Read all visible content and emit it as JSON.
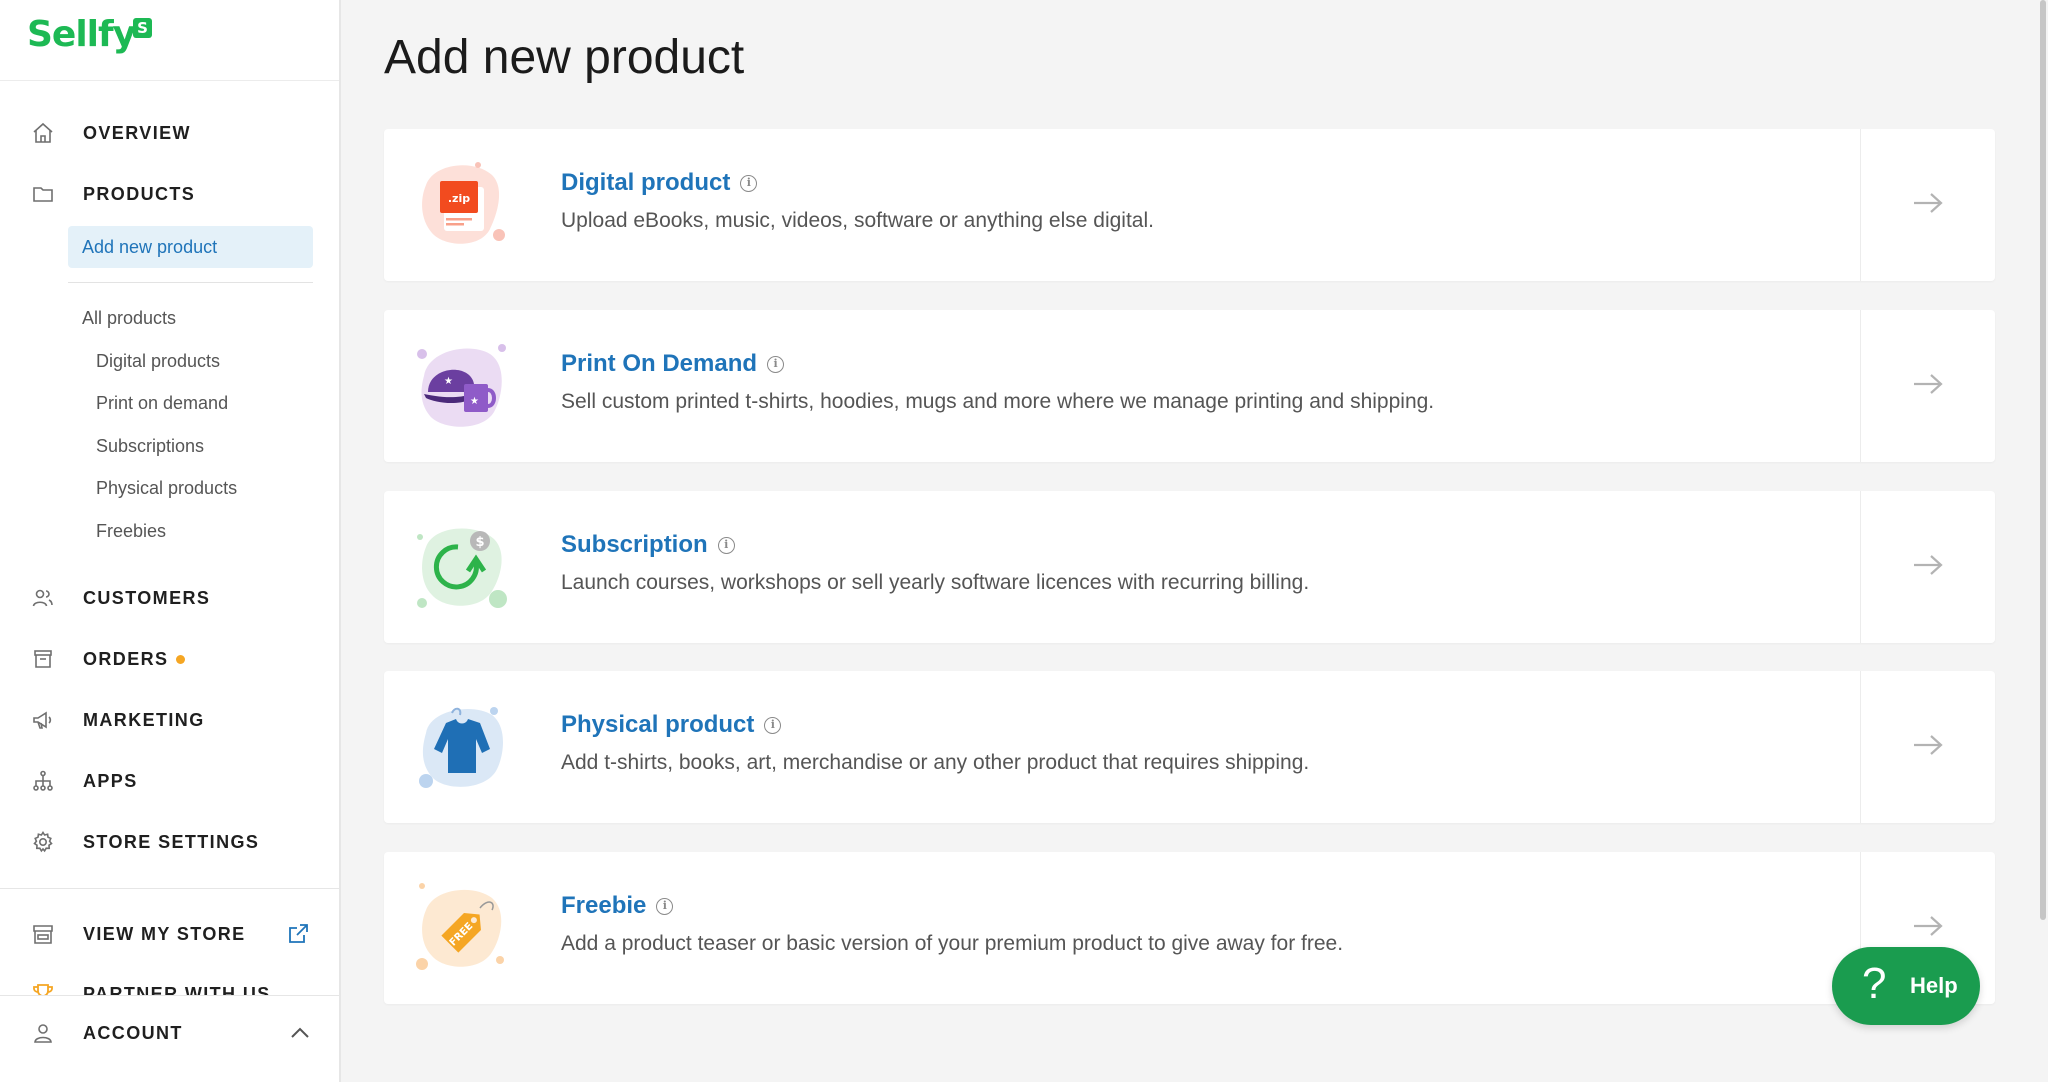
{
  "brand": {
    "name": "Sellfy",
    "badge": "S",
    "color": "#1db954"
  },
  "sidebar": {
    "nav": [
      {
        "key": "overview",
        "label": "OVERVIEW",
        "icon": "home-icon"
      },
      {
        "key": "products",
        "label": "PRODUCTS",
        "icon": "folder-icon"
      },
      {
        "key": "customers",
        "label": "CUSTOMERS",
        "icon": "customers-icon"
      },
      {
        "key": "orders",
        "label": "ORDERS",
        "icon": "orders-icon",
        "indicator_color": "#f5a623"
      },
      {
        "key": "marketing",
        "label": "MARKETING",
        "icon": "megaphone-icon"
      },
      {
        "key": "apps",
        "label": "APPS",
        "icon": "apps-icon"
      },
      {
        "key": "store_settings",
        "label": "STORE SETTINGS",
        "icon": "gear-icon"
      }
    ],
    "products_sub": {
      "active": "Add new product",
      "all": "All products",
      "children": [
        "Digital products",
        "Print on demand",
        "Subscriptions",
        "Physical products",
        "Freebies"
      ]
    },
    "view_store": {
      "label": "VIEW MY STORE",
      "icon": "store-icon",
      "external_icon": "external-link-icon"
    },
    "partner": {
      "label": "PARTNER WITH US",
      "icon": "trophy-icon"
    },
    "account": {
      "label": "ACCOUNT",
      "icon": "user-icon",
      "toggle_icon": "chevron-up-icon"
    }
  },
  "main": {
    "title": "Add new product",
    "cards": [
      {
        "title": "Digital product",
        "desc": "Upload eBooks, music, videos, software or anything else digital.",
        "illustration": "zip-file-icon",
        "badge_text": ".zip"
      },
      {
        "title": "Print On Demand",
        "desc": "Sell custom printed t-shirts, hoodies, mugs and more where we manage printing and shipping.",
        "illustration": "cap-mug-icon"
      },
      {
        "title": "Subscription",
        "desc": "Launch courses, workshops or sell yearly software licences with recurring billing.",
        "illustration": "recurring-payment-icon",
        "badge_text": "$"
      },
      {
        "title": "Physical product",
        "desc": "Add t-shirts, books, art, merchandise or any other product that requires shipping.",
        "illustration": "sweater-icon"
      },
      {
        "title": "Freebie",
        "desc": "Add a product teaser or basic version of your premium product to give away for free.",
        "illustration": "free-tag-icon",
        "badge_text": "FREE"
      }
    ],
    "accent_link_color": "#1f74b9"
  },
  "help": {
    "label": "Help",
    "symbol": "?",
    "color": "#1a9c4f"
  }
}
